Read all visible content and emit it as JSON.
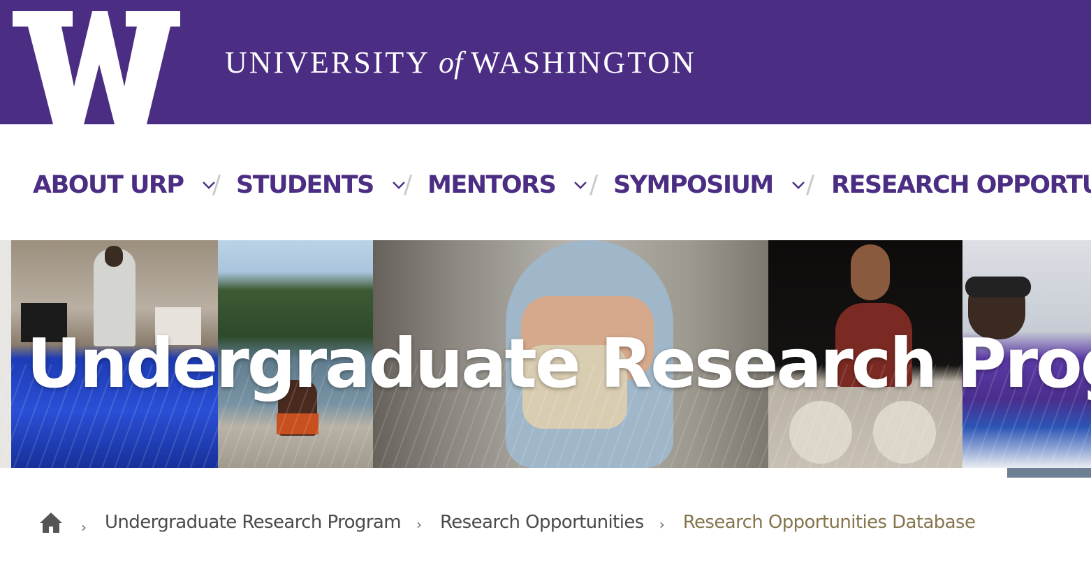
{
  "brand": {
    "wordmark_left": "UNIVERSITY",
    "wordmark_of": "of",
    "wordmark_right": "WASHINGTON",
    "logo_icon": "w-logo-icon",
    "colors": {
      "purple": "#4b2e83",
      "gold": "#85754d",
      "white": "#ffffff"
    }
  },
  "nav": {
    "items": [
      {
        "label": "ABOUT URP",
        "icon": "chevron-down-icon"
      },
      {
        "label": "STUDENTS",
        "icon": "chevron-down-icon"
      },
      {
        "label": "MENTORS",
        "icon": "chevron-down-icon"
      },
      {
        "label": "SYMPOSIUM",
        "icon": "chevron-down-icon"
      },
      {
        "label": "RESEARCH OPPORTUN"
      }
    ],
    "separator": "/"
  },
  "hero": {
    "title": "Undergraduate Research Program"
  },
  "breadcrumb": {
    "home_icon": "home-icon",
    "separator": "›",
    "items": [
      {
        "label": "Undergraduate Research Program"
      },
      {
        "label": "Research Opportunities"
      },
      {
        "label": "Research Opportunities Database",
        "current": true
      }
    ]
  }
}
